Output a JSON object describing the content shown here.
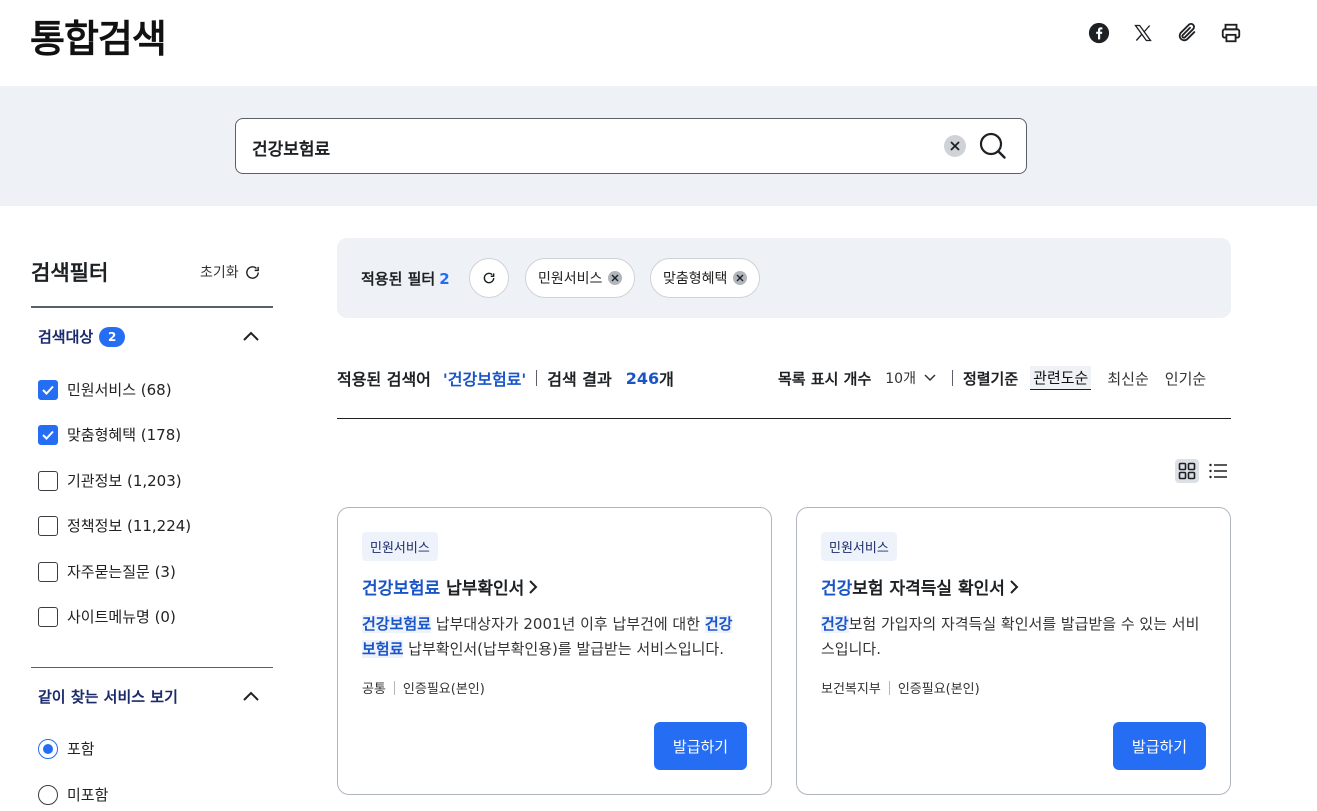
{
  "header": {
    "title": "통합검색",
    "share_icons": [
      "facebook-icon",
      "x-icon",
      "paperclip-icon",
      "printer-icon"
    ]
  },
  "search": {
    "value": "건강보험료",
    "placeholder": ""
  },
  "sidebar": {
    "title": "검색필터",
    "reset_label": "초기화",
    "section1": {
      "title": "검색대상",
      "count": "2",
      "items": [
        {
          "label": "민원서비스 (68)",
          "checked": true
        },
        {
          "label": "맞춤형혜택 (178)",
          "checked": true
        },
        {
          "label": "기관정보 (1,203)",
          "checked": false
        },
        {
          "label": "정책정보 (11,224)",
          "checked": false
        },
        {
          "label": "자주묻는질문 (3)",
          "checked": false
        },
        {
          "label": "사이트메뉴명 (0)",
          "checked": false
        }
      ]
    },
    "section2": {
      "title": "같이 찾는 서비스 보기",
      "options": [
        {
          "label": "포함",
          "selected": true
        },
        {
          "label": "미포함",
          "selected": false
        }
      ]
    }
  },
  "applied_filters": {
    "label": "적용된 필터",
    "count": "2",
    "chips": [
      "민원서비스",
      "맞춤형혜택"
    ]
  },
  "results_info": {
    "query_label": "적용된 검색어",
    "query_value": "'건강보험료'",
    "result_label": "검색 결과",
    "result_count": "246",
    "result_unit": "개"
  },
  "sort": {
    "page_size_label": "목록 표시 개수",
    "page_size_value": "10개",
    "sort_label": "정렬기준",
    "options": [
      "관련도순",
      "최신순",
      "인기순"
    ],
    "active": "관련도순"
  },
  "view_modes": {
    "active": "grid"
  },
  "cards": [
    {
      "tag": "민원서비스",
      "title_hl": "건강보험료",
      "title_rest": " 납부확인서",
      "desc_parts": [
        {
          "text": "건강보험료",
          "hl": true
        },
        {
          "text": " 납부대상자가 2001년 이후 납부건에 대한 ",
          "hl": false
        },
        {
          "text": "건강보험료",
          "hl": true
        },
        {
          "text": " 납부확인서(납부확인용)를 발급받는 서비스입니다.",
          "hl": false
        }
      ],
      "meta": [
        "공통",
        "인증필요(본인)"
      ],
      "button": "발급하기"
    },
    {
      "tag": "민원서비스",
      "title_hl": "건강",
      "title_rest": "보험 자격득실 확인서",
      "desc_parts": [
        {
          "text": "건강",
          "hl": true
        },
        {
          "text": "보험 가입자의 자격득실 확인서를 발급받을 수 있는 서비스입니다.",
          "hl": false
        }
      ],
      "meta": [
        "보건복지부",
        "인증필요(본인)"
      ],
      "button": "발급하기"
    }
  ],
  "colors": {
    "accent": "#256ef4",
    "highlight": "#1a55c8",
    "band": "#eef1f5"
  }
}
